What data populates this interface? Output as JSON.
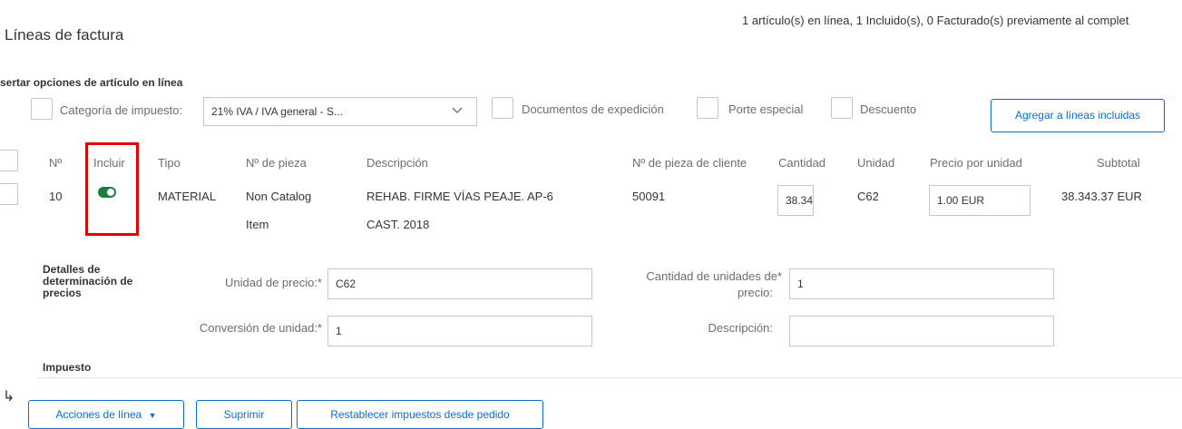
{
  "header": {
    "title": "Líneas de factura",
    "summary": "1 artículo(s) en línea,  1 Incluido(s),  0 Facturado(s) previamente al complet"
  },
  "options": {
    "section_title": "sertar opciones de artículo en línea",
    "tax_category_label": "Categoría de impuesto:",
    "tax_category_value": "21% IVA / IVA general - S...",
    "shipping_docs_label": "Documentos de expedición",
    "special_freight_label": "Porte especial",
    "discount_label": "Descuento",
    "add_button_label": "Agregar a líneas incluidas"
  },
  "table": {
    "headers": {
      "no": "Nº",
      "include": "Incluir",
      "type": "Tipo",
      "part_no": "Nº de pieza",
      "description": "Descripción",
      "customer_part_no": "Nº de pieza de cliente",
      "quantity": "Cantidad",
      "unit": "Unidad",
      "unit_price": "Precio por unidad",
      "subtotal": "Subtotal"
    },
    "row": {
      "no": "10",
      "include": true,
      "type": "MATERIAL",
      "part_no_line1": "Non Catalog",
      "part_no_line2": "Item",
      "description_line1": "REHAB. FIRME VÍAS PEAJE. AP-6",
      "description_line2": "CAST. 2018",
      "customer_part_no": "50091",
      "quantity": "38.34",
      "unit": "C62",
      "unit_price": "1.00 EUR",
      "subtotal": "38.343.37 EUR"
    }
  },
  "pricing": {
    "section_label": "Detalles de determinación de precios",
    "price_unit_label": "Unidad de precio:*",
    "price_unit_value": "C62",
    "price_unit_qty_label_line1": "Cantidad de unidades de*",
    "price_unit_qty_label_line2": "precio:",
    "price_unit_qty_value": "1",
    "unit_conversion_label": "Conversión de unidad:*",
    "unit_conversion_value": "1",
    "description_label": "Descripción:",
    "description_value": ""
  },
  "tax": {
    "section_label": "Impuesto"
  },
  "footer": {
    "arrow": "↳",
    "line_actions_label": "Acciones de línea",
    "delete_label": "Suprimir",
    "reset_taxes_label": "Restablecer impuestos desde pedido"
  },
  "colors": {
    "accent": "#0a6ed1",
    "toggle_on": "#1a7e3c",
    "highlight": "#e00000"
  }
}
